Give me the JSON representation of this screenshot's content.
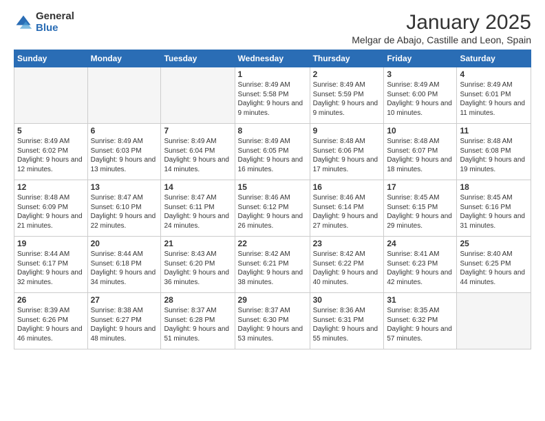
{
  "logo": {
    "general": "General",
    "blue": "Blue"
  },
  "title": "January 2025",
  "subtitle": "Melgar de Abajo, Castille and Leon, Spain",
  "headers": [
    "Sunday",
    "Monday",
    "Tuesday",
    "Wednesday",
    "Thursday",
    "Friday",
    "Saturday"
  ],
  "weeks": [
    [
      {
        "day": "",
        "info": ""
      },
      {
        "day": "",
        "info": ""
      },
      {
        "day": "",
        "info": ""
      },
      {
        "day": "1",
        "info": "Sunrise: 8:49 AM\nSunset: 5:58 PM\nDaylight: 9 hours\nand 9 minutes."
      },
      {
        "day": "2",
        "info": "Sunrise: 8:49 AM\nSunset: 5:59 PM\nDaylight: 9 hours\nand 9 minutes."
      },
      {
        "day": "3",
        "info": "Sunrise: 8:49 AM\nSunset: 6:00 PM\nDaylight: 9 hours\nand 10 minutes."
      },
      {
        "day": "4",
        "info": "Sunrise: 8:49 AM\nSunset: 6:01 PM\nDaylight: 9 hours\nand 11 minutes."
      }
    ],
    [
      {
        "day": "5",
        "info": "Sunrise: 8:49 AM\nSunset: 6:02 PM\nDaylight: 9 hours\nand 12 minutes."
      },
      {
        "day": "6",
        "info": "Sunrise: 8:49 AM\nSunset: 6:03 PM\nDaylight: 9 hours\nand 13 minutes."
      },
      {
        "day": "7",
        "info": "Sunrise: 8:49 AM\nSunset: 6:04 PM\nDaylight: 9 hours\nand 14 minutes."
      },
      {
        "day": "8",
        "info": "Sunrise: 8:49 AM\nSunset: 6:05 PM\nDaylight: 9 hours\nand 16 minutes."
      },
      {
        "day": "9",
        "info": "Sunrise: 8:48 AM\nSunset: 6:06 PM\nDaylight: 9 hours\nand 17 minutes."
      },
      {
        "day": "10",
        "info": "Sunrise: 8:48 AM\nSunset: 6:07 PM\nDaylight: 9 hours\nand 18 minutes."
      },
      {
        "day": "11",
        "info": "Sunrise: 8:48 AM\nSunset: 6:08 PM\nDaylight: 9 hours\nand 19 minutes."
      }
    ],
    [
      {
        "day": "12",
        "info": "Sunrise: 8:48 AM\nSunset: 6:09 PM\nDaylight: 9 hours\nand 21 minutes."
      },
      {
        "day": "13",
        "info": "Sunrise: 8:47 AM\nSunset: 6:10 PM\nDaylight: 9 hours\nand 22 minutes."
      },
      {
        "day": "14",
        "info": "Sunrise: 8:47 AM\nSunset: 6:11 PM\nDaylight: 9 hours\nand 24 minutes."
      },
      {
        "day": "15",
        "info": "Sunrise: 8:46 AM\nSunset: 6:12 PM\nDaylight: 9 hours\nand 26 minutes."
      },
      {
        "day": "16",
        "info": "Sunrise: 8:46 AM\nSunset: 6:14 PM\nDaylight: 9 hours\nand 27 minutes."
      },
      {
        "day": "17",
        "info": "Sunrise: 8:45 AM\nSunset: 6:15 PM\nDaylight: 9 hours\nand 29 minutes."
      },
      {
        "day": "18",
        "info": "Sunrise: 8:45 AM\nSunset: 6:16 PM\nDaylight: 9 hours\nand 31 minutes."
      }
    ],
    [
      {
        "day": "19",
        "info": "Sunrise: 8:44 AM\nSunset: 6:17 PM\nDaylight: 9 hours\nand 32 minutes."
      },
      {
        "day": "20",
        "info": "Sunrise: 8:44 AM\nSunset: 6:18 PM\nDaylight: 9 hours\nand 34 minutes."
      },
      {
        "day": "21",
        "info": "Sunrise: 8:43 AM\nSunset: 6:20 PM\nDaylight: 9 hours\nand 36 minutes."
      },
      {
        "day": "22",
        "info": "Sunrise: 8:42 AM\nSunset: 6:21 PM\nDaylight: 9 hours\nand 38 minutes."
      },
      {
        "day": "23",
        "info": "Sunrise: 8:42 AM\nSunset: 6:22 PM\nDaylight: 9 hours\nand 40 minutes."
      },
      {
        "day": "24",
        "info": "Sunrise: 8:41 AM\nSunset: 6:23 PM\nDaylight: 9 hours\nand 42 minutes."
      },
      {
        "day": "25",
        "info": "Sunrise: 8:40 AM\nSunset: 6:25 PM\nDaylight: 9 hours\nand 44 minutes."
      }
    ],
    [
      {
        "day": "26",
        "info": "Sunrise: 8:39 AM\nSunset: 6:26 PM\nDaylight: 9 hours\nand 46 minutes."
      },
      {
        "day": "27",
        "info": "Sunrise: 8:38 AM\nSunset: 6:27 PM\nDaylight: 9 hours\nand 48 minutes."
      },
      {
        "day": "28",
        "info": "Sunrise: 8:37 AM\nSunset: 6:28 PM\nDaylight: 9 hours\nand 51 minutes."
      },
      {
        "day": "29",
        "info": "Sunrise: 8:37 AM\nSunset: 6:30 PM\nDaylight: 9 hours\nand 53 minutes."
      },
      {
        "day": "30",
        "info": "Sunrise: 8:36 AM\nSunset: 6:31 PM\nDaylight: 9 hours\nand 55 minutes."
      },
      {
        "day": "31",
        "info": "Sunrise: 8:35 AM\nSunset: 6:32 PM\nDaylight: 9 hours\nand 57 minutes."
      },
      {
        "day": "",
        "info": ""
      }
    ]
  ]
}
